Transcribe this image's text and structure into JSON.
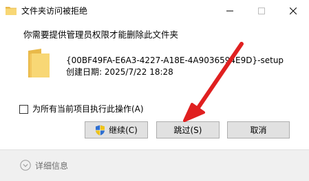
{
  "window": {
    "title": "文件夹访问被拒绝",
    "minimize_icon": "minimize-icon",
    "maximize_icon": "maximize-icon",
    "close_icon": "close-icon"
  },
  "dialog": {
    "heading": "你需要提供管理员权限才能删除此文件夹",
    "item": {
      "icon": "folder-icon",
      "name": "{00BF49FA-E6A3-4227-A18E-4A9036594E9D}-setup",
      "created": "创建日期: 2025/7/22 18:28"
    },
    "apply_all_label": "为所有当前项目执行此操作(A)",
    "apply_all_checked": false,
    "buttons": {
      "continue": "继续(C)",
      "continue_icon": "uac-shield-icon",
      "skip": "跳过(S)",
      "cancel": "取消"
    }
  },
  "footer": {
    "details_label": "详细信息",
    "details_icon": "chevron-down-circle-icon"
  },
  "colors": {
    "folder": "#f8d775",
    "button_bg": "#e1e1e1",
    "button_border": "#adadad",
    "footer_bg": "#f0f0f0",
    "annotation_arrow": "#e02020"
  }
}
